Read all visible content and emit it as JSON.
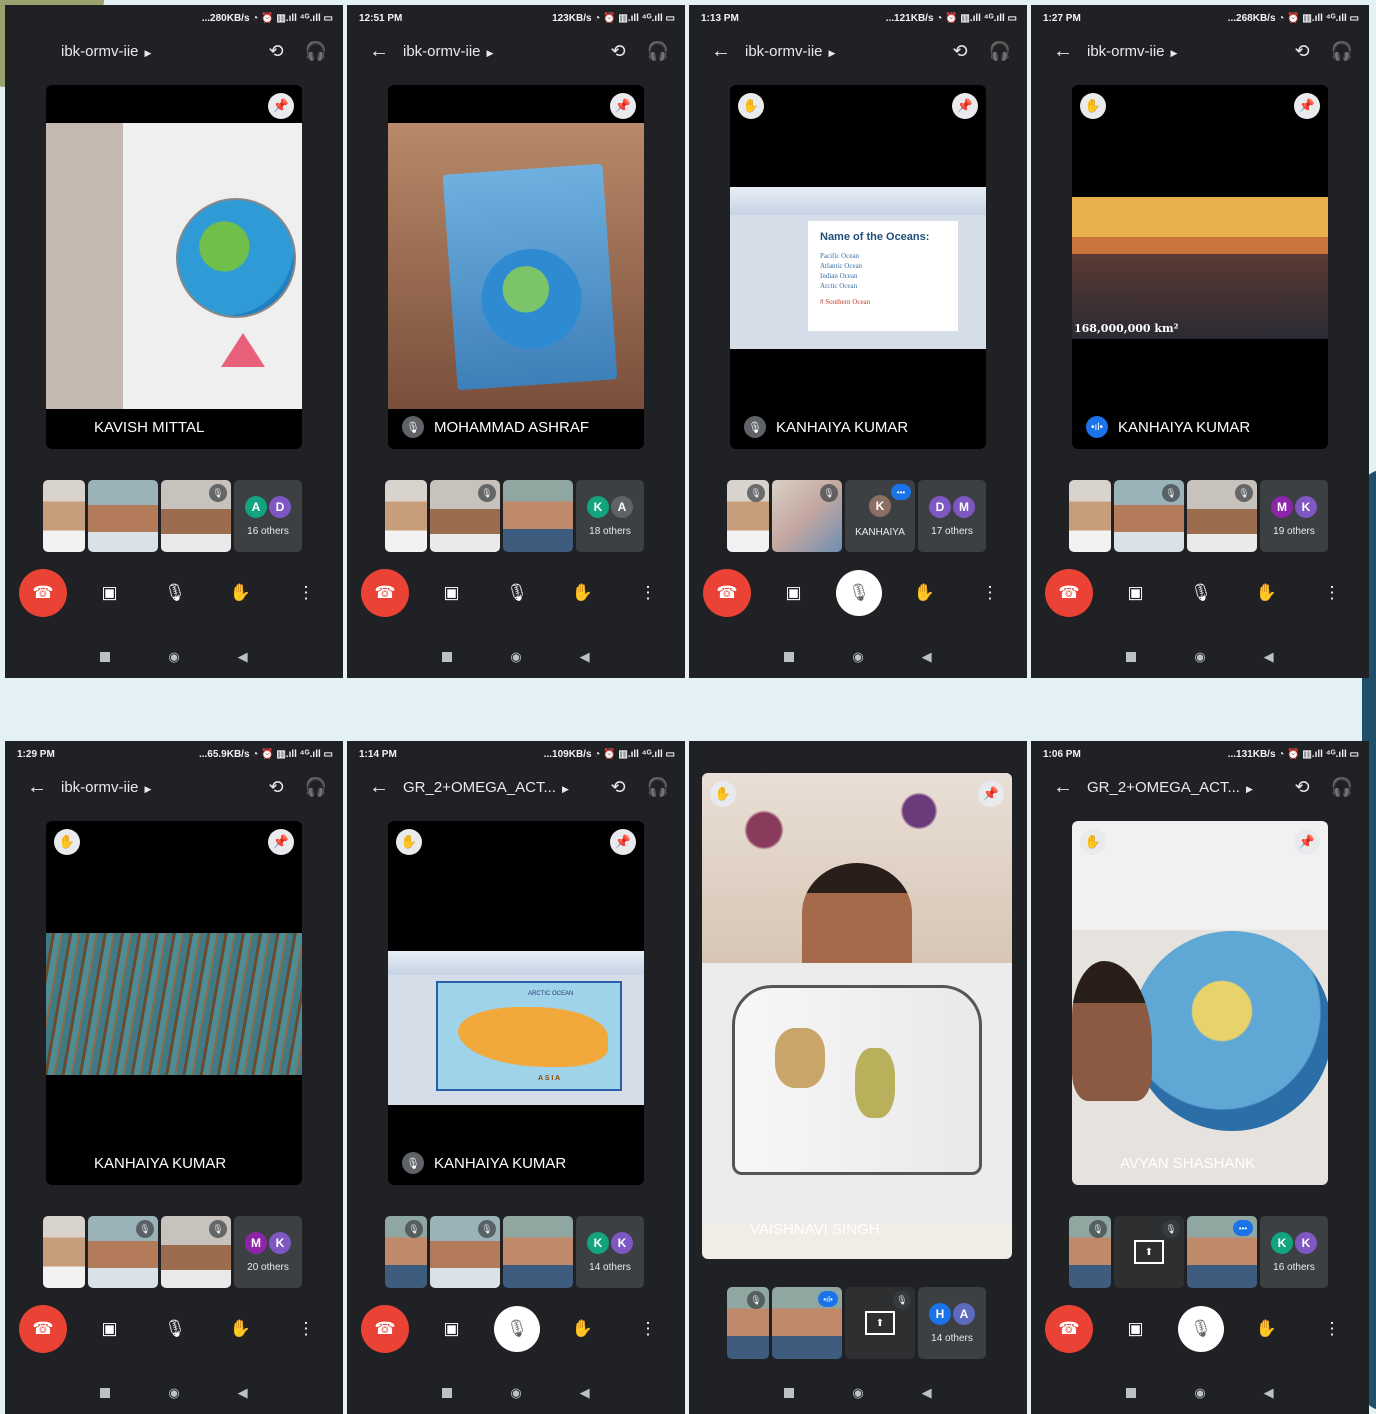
{
  "phones": [
    {
      "status_left": "",
      "status_right": "...280KB/s ◔ ⏰ ▥.ıll ⁴ᴳ.ıll ▭",
      "meeting": "ibk-ormv-iie",
      "speaker": "KAVISH MITTAL",
      "others_label": "16 others",
      "avatars": [
        "A",
        "D"
      ],
      "avatar_colors": [
        "#12a37f",
        "#7e57c2"
      ]
    },
    {
      "status_left": "12:51 PM",
      "status_right": "123KB/s ◔ ⏰ ▥.ıll ⁴ᴳ.ıll ▭",
      "meeting": "ibk-ormv-iie",
      "speaker": "MOHAMMAD ASHRAF",
      "others_label": "18 others",
      "avatars": [
        "K",
        "A"
      ],
      "avatar_colors": [
        "#12a37f",
        "#5f6368"
      ]
    },
    {
      "status_left": "1:13 PM",
      "status_right": "...121KB/s ◔ ⏰ ▥.ıll ⁴ᴳ.ıll ▭",
      "meeting": "ibk-ormv-iie",
      "speaker": "KANHAIYA KUMAR",
      "others_label": "17 others",
      "avatars": [
        "D",
        "M"
      ],
      "avatar_colors": [
        "#7e57c2",
        "#7e57c2"
      ],
      "extra_tile_label": "KANHAIYA",
      "extra_tile_avatar": "K",
      "slide_title": "Name of the Oceans:",
      "slide_items": [
        "Pacific Ocean",
        "Atlantic Ocean",
        "Indian Ocean",
        "Arctic Ocean"
      ],
      "slide_extra": "# Southern Ocean"
    },
    {
      "status_left": "1:27 PM",
      "status_right": "...268KB/s ◔ ⏰ ▥.ıll ⁴ᴳ.ıll ▭",
      "meeting": "ibk-ormv-iie",
      "speaker": "KANHAIYA KUMAR",
      "others_label": "19 others",
      "avatars": [
        "M",
        "K"
      ],
      "avatar_colors": [
        "#8e24aa",
        "#7e57c2"
      ],
      "media_caption": "168,000,000 km²"
    },
    {
      "status_left": "1:29 PM",
      "status_right": "...65.9KB/s ◔ ⏰ ▥.ıll ⁴ᴳ.ıll ▭",
      "meeting": "ibk-ormv-iie",
      "speaker": "KANHAIYA KUMAR",
      "others_label": "20 others",
      "avatars": [
        "M",
        "K"
      ],
      "avatar_colors": [
        "#8e24aa",
        "#7e57c2"
      ]
    },
    {
      "status_left": "1:14 PM",
      "status_right": "...109KB/s ◔ ⏰ ▥.ıll ⁴ᴳ.ıll ▭",
      "meeting": "GR_2+OMEGA_ACT...",
      "speaker": "KANHAIYA KUMAR",
      "others_label": "14 others",
      "avatars": [
        "K",
        "K"
      ],
      "avatar_colors": [
        "#12a37f",
        "#7e57c2"
      ],
      "map_labels": [
        "ARCTIC OCEAN",
        "A S I A"
      ]
    },
    {
      "status_left": "",
      "status_right": "",
      "meeting": "",
      "speaker": "VAISHNAVI SINGH",
      "others_label": "14 others",
      "avatars": [
        "H",
        "A"
      ],
      "avatar_colors": [
        "#1a73e8",
        "#5c6bc0"
      ]
    },
    {
      "status_left": "1:06 PM",
      "status_right": "...131KB/s ◔ ⏰ ▥.ıll ⁴ᴳ.ıll ▭",
      "meeting": "GR_2+OMEGA_ACT...",
      "speaker": "AVYAN SHASHANK",
      "others_label": "16 others",
      "avatars": [
        "K",
        "K"
      ],
      "avatar_colors": [
        "#12a37f",
        "#7e57c2"
      ]
    }
  ],
  "icons": {
    "back": "back-arrow-icon",
    "switch_camera": "switch-camera-icon",
    "audio": "headphones-icon",
    "pin": "pin-icon",
    "hand": "raise-hand-icon",
    "end": "end-call-icon",
    "camera": "camera-icon",
    "mic": "microphone-icon",
    "more": "more-vert-icon"
  }
}
